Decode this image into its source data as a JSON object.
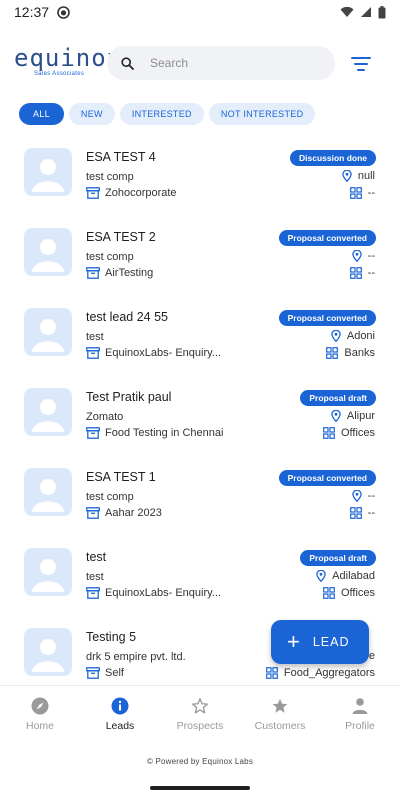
{
  "status_bar": {
    "time": "12:37"
  },
  "header": {
    "logo_text": "equinox",
    "logo_sub": "Sales Associates",
    "search_placeholder": "Search"
  },
  "chips": [
    "ALL",
    "NEW",
    "INTERESTED",
    "NOT INTERESTED"
  ],
  "leads": [
    {
      "name": "ESA TEST 4",
      "company": "test comp",
      "source": "Zohocorporate",
      "status": "Discussion done",
      "location": "null",
      "industry": "--"
    },
    {
      "name": "ESA TEST 2",
      "company": "test comp",
      "source": "AirTesting",
      "status": "Proposal converted",
      "location": "--",
      "industry": "--"
    },
    {
      "name": "test lead 24 55",
      "company": "test",
      "source": "EquinoxLabs- Enquiry...",
      "status": "Proposal converted",
      "location": "Adoni",
      "industry": "Banks"
    },
    {
      "name": "Test Pratik paul",
      "company": "Zomato",
      "source": "Food Testing in Chennai",
      "status": "Proposal draft",
      "location": "Alipur",
      "industry": "Offices"
    },
    {
      "name": "ESA TEST 1",
      "company": "test comp",
      "source": "Aahar 2023",
      "status": "Proposal converted",
      "location": "--",
      "industry": "--"
    },
    {
      "name": "test",
      "company": "test",
      "source": "EquinoxLabs- Enquiry...",
      "status": "Proposal draft",
      "location": "Adilabad",
      "industry": "Offices"
    },
    {
      "name": "Testing 5",
      "company": "drk 5 empire pvt. ltd.",
      "source": "Self",
      "status": "",
      "location": "e",
      "industry": "Food_Aggregators"
    }
  ],
  "fab": {
    "label": "LEAD"
  },
  "nav": [
    {
      "label": "Home",
      "icon": "compass-icon"
    },
    {
      "label": "Leads",
      "icon": "info-icon"
    },
    {
      "label": "Prospects",
      "icon": "star-outline-icon"
    },
    {
      "label": "Customers",
      "icon": "star-filled-icon"
    },
    {
      "label": "Profile",
      "icon": "person-icon"
    }
  ],
  "footer": "© Powered by Equinox Labs",
  "colors": {
    "accent": "#1a64d6",
    "chip_bg": "#e4eefb",
    "avatar_bg": "#dbe8fa"
  }
}
